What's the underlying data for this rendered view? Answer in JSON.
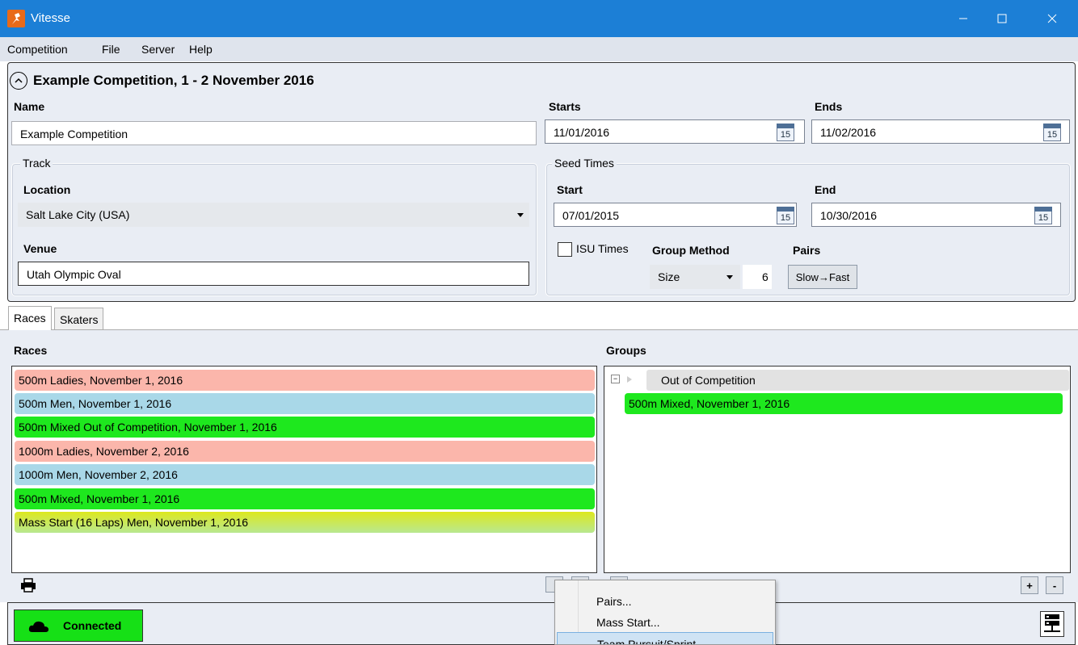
{
  "window": {
    "title": "Vitesse",
    "min": "—",
    "max": "☐",
    "close": "✕"
  },
  "menu": [
    "Competition",
    "File",
    "Server",
    "Help"
  ],
  "competition": {
    "header": "Example Competition, 1 - 2 November 2016",
    "name_label": "Name",
    "name_value": "Example Competition",
    "starts_label": "Starts",
    "starts_value": "11/01/2016",
    "ends_label": "Ends",
    "ends_value": "11/02/2016",
    "calendar_glyph": "15"
  },
  "track": {
    "group_title": "Track",
    "location_label": "Location",
    "location_value": "Salt Lake City (USA)",
    "venue_label": "Venue",
    "venue_value": "Utah Olympic Oval"
  },
  "seed_times": {
    "group_title": "Seed Times",
    "start_label": "Start",
    "start_value": "07/01/2015",
    "end_label": "End",
    "end_value": "10/30/2016",
    "isu_label": "ISU Times",
    "isu_checked": false,
    "group_method_label": "Group Method",
    "group_method_value": "Size",
    "group_size": "6",
    "pairs_label": "Pairs",
    "pairs_button": "Slow→Fast"
  },
  "tabs": [
    "Races",
    "Skaters"
  ],
  "races": {
    "label": "Races",
    "items": [
      {
        "text": "500m Ladies, November 1, 2016",
        "color": "#fbb6ab"
      },
      {
        "text": "500m Men, November 1, 2016",
        "color": "#a9d8e8"
      },
      {
        "text": "500m Mixed Out of Competition, November 1, 2016",
        "color": "#1ee81e"
      },
      {
        "text": "1000m Ladies, November 2, 2016",
        "color": "#fbb6ab"
      },
      {
        "text": "1000m Men, November 2, 2016",
        "color": "#a9d8e8"
      },
      {
        "text": "500m Mixed, November 1, 2016",
        "color": "#1ee81e"
      },
      {
        "text": "Mass Start (16 Laps) Men, November 1, 2016",
        "color": "#dde81e"
      }
    ]
  },
  "groups": {
    "label": "Groups",
    "group_name": "Out of Competition",
    "child": "500m Mixed, November 1, 2016"
  },
  "buttons": {
    "add": "+",
    "remove": "-"
  },
  "status": {
    "connection": "Connected"
  },
  "context_menu": [
    "Pairs...",
    "Mass Start...",
    "Team Pursuit/Sprint..."
  ]
}
